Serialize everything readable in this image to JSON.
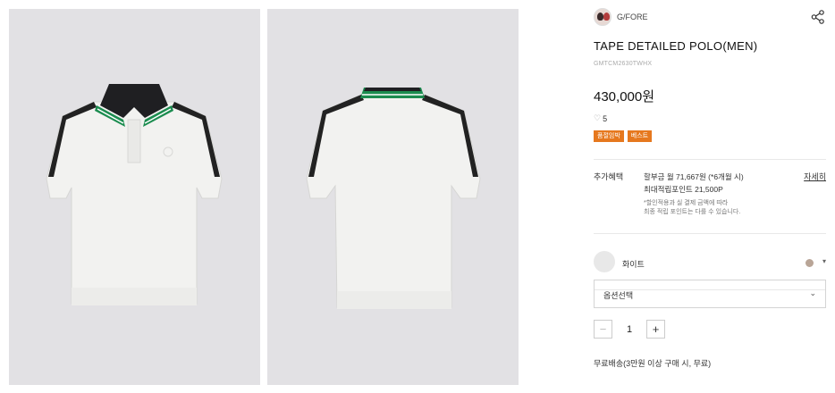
{
  "brand": {
    "name": "G/FORE"
  },
  "product": {
    "title": "TAPE DETAILED POLO(MEN)",
    "sku": "GMTCM2630TWHX",
    "price": "430,000원",
    "likes": "5",
    "tags": [
      "품절임박",
      "베스트"
    ]
  },
  "images": [
    {
      "view": "front"
    },
    {
      "view": "back"
    }
  ],
  "benefit": {
    "label": "추가혜택",
    "installment": "할부금 월 71,667원 (*6개월 시)",
    "points": "최대적립포인트 21,500P",
    "note_line1": "*할인적용과 실 결제 금액에 따라",
    "note_line2": "최종 적립 포인트는 다를 수 있습니다.",
    "more": "자세히"
  },
  "color": {
    "name": "화이트",
    "dot_color": "#b9a597"
  },
  "option_select": {
    "placeholder": "옵션선택"
  },
  "quantity": {
    "minus": "−",
    "value": "1",
    "plus": "+"
  },
  "shipping": "무료배송(3만원 이상 구매 시, 무료)",
  "icons": {
    "share": "share-icon",
    "heart": "heart-icon",
    "chevron": "chevron-down-icon"
  }
}
